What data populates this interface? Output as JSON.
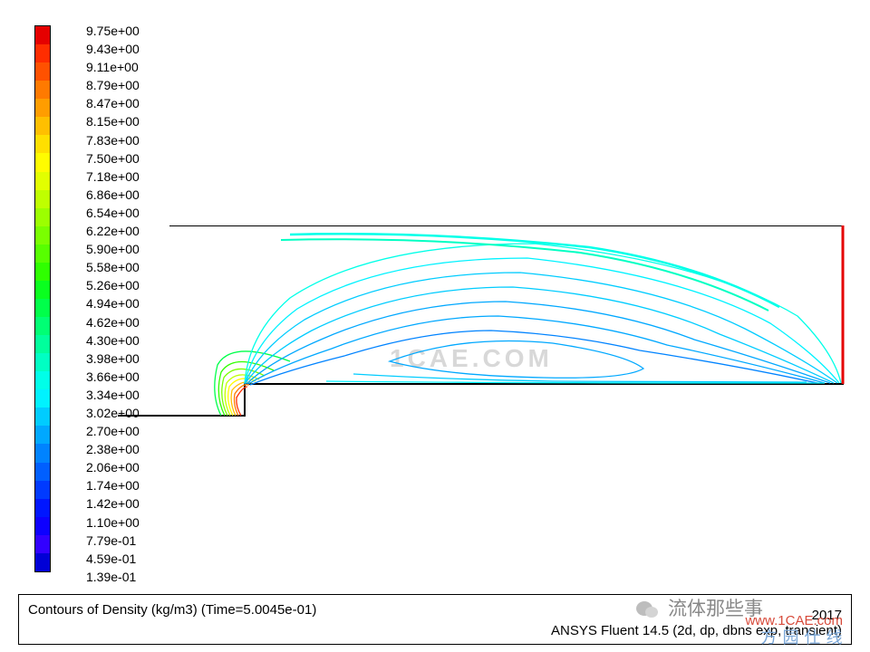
{
  "chart_data": {
    "type": "contour",
    "title": "Contours of Density (kg/m3)  (Time=5.0045e-01)",
    "product": "ANSYS Fluent 14.5 (2d, dp, dbns exp, transient)",
    "date": "2017",
    "legend": {
      "unit": "kg/m3",
      "levels": [
        "9.75e+00",
        "9.43e+00",
        "9.11e+00",
        "8.79e+00",
        "8.47e+00",
        "8.15e+00",
        "7.83e+00",
        "7.50e+00",
        "7.18e+00",
        "6.86e+00",
        "6.54e+00",
        "6.22e+00",
        "5.90e+00",
        "5.58e+00",
        "5.26e+00",
        "4.94e+00",
        "4.62e+00",
        "4.30e+00",
        "3.98e+00",
        "3.66e+00",
        "3.34e+00",
        "3.02e+00",
        "2.70e+00",
        "2.38e+00",
        "2.06e+00",
        "1.74e+00",
        "1.42e+00",
        "1.10e+00",
        "7.79e-01",
        "4.59e-01",
        "1.39e-01"
      ],
      "colors": [
        "#e50000",
        "#ff2d00",
        "#ff5100",
        "#ff7a00",
        "#ff9d00",
        "#ffbf00",
        "#ffdf00",
        "#fffc00",
        "#e2ff00",
        "#bfff00",
        "#9cff00",
        "#7aff00",
        "#57ff00",
        "#2fff00",
        "#0aff1f",
        "#00ff4a",
        "#00ff74",
        "#00ff9c",
        "#00ffc3",
        "#00ffe8",
        "#00f2ff",
        "#00ccff",
        "#00a8ff",
        "#0083ff",
        "#005fff",
        "#003aff",
        "#0016ff",
        "#0d00ff",
        "#3200ff",
        "#0000d6"
      ]
    },
    "domain": {
      "geometry": "forward-facing step channel, 2D axisymmetric half-section",
      "xrange_approx": [
        0,
        1.0
      ],
      "yrange_approx": [
        0,
        0.35
      ],
      "step_location_x": 0.16,
      "step_height_fraction": 0.32
    },
    "watermarks": {
      "center": "1CAE.COM",
      "bottom_cn": "流体那些事",
      "bottom_red": "www.1CAE.com",
      "bottom_blue": "方 园 仕 线"
    }
  },
  "caption": {
    "left": "Contours of Density (kg/m3)  (Time=5.0045e-01)",
    "date": "2017",
    "product": "ANSYS Fluent 14.5 (2d, dp, dbns exp, transient)"
  },
  "watermarks": {
    "center": "1CAE.COM",
    "cn": "流体那些事",
    "red": "www.1CAE.com",
    "blue": "方 园 仕 线"
  }
}
